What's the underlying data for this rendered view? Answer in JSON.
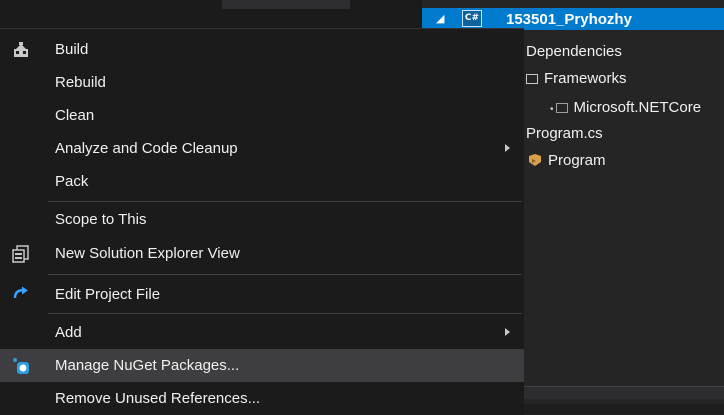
{
  "menu": {
    "items": [
      {
        "label": "Build",
        "icon": "build-icon"
      },
      {
        "label": "Rebuild"
      },
      {
        "label": "Clean"
      },
      {
        "label": "Analyze and Code Cleanup",
        "submenu": true
      },
      {
        "label": "Pack"
      },
      {
        "label": "Scope to This"
      },
      {
        "label": "New Solution Explorer View",
        "icon": "new-view-icon"
      },
      {
        "label": "Edit Project File",
        "icon": "edit-project-icon"
      },
      {
        "label": "Add",
        "submenu": true
      },
      {
        "label": "Manage NuGet Packages...",
        "icon": "nuget-icon",
        "highlighted": true
      },
      {
        "label": "Remove Unused References..."
      }
    ]
  },
  "solution_explorer": {
    "project": "153501_Pryhozhy",
    "project_icon_text": "C#",
    "tree": {
      "dependencies": "Dependencies",
      "frameworks": "Frameworks",
      "netcore": "Microsoft.NETCore",
      "programcs": "Program.cs",
      "program": "Program"
    }
  },
  "colors": {
    "menu_bg": "#1b1b1c",
    "highlight": "#3e3e40",
    "selection": "#007acc",
    "separator": "#3f3f46",
    "nuget_blue": "#2d9ee0"
  }
}
